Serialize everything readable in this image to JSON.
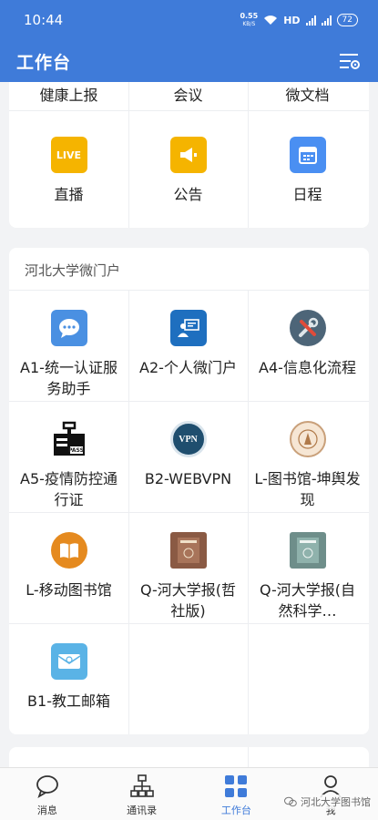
{
  "status_bar": {
    "time": "10:44",
    "net_speed": "0.55",
    "net_unit": "KB/S",
    "hd": "HD",
    "battery": "72"
  },
  "app_bar": {
    "title": "工作台"
  },
  "section_top": {
    "items": [
      {
        "label": "健康上报"
      },
      {
        "label": "会议"
      },
      {
        "label": "微文档"
      },
      {
        "label": "直播",
        "icon_text": "LIVE"
      },
      {
        "label": "公告"
      },
      {
        "label": "日程"
      }
    ]
  },
  "section_portal": {
    "title": "河北大学微门户",
    "items": [
      {
        "label": "A1-统一认证服务助手"
      },
      {
        "label": "A2-个人微门户"
      },
      {
        "label": "A4-信息化流程"
      },
      {
        "label": "A5-疫情防控通行证",
        "icon_text": "PASS"
      },
      {
        "label": "B2-WEBVPN",
        "icon_text": "VPN"
      },
      {
        "label": "L-图书馆-坤舆发现"
      },
      {
        "label": "L-移动图书馆"
      },
      {
        "label": "Q-河大学报(哲社版)"
      },
      {
        "label": "Q-河大学报(自然科学…"
      },
      {
        "label": "B1-教工邮箱"
      }
    ]
  },
  "tabbar": {
    "tabs": [
      {
        "label": "消息"
      },
      {
        "label": "通讯录"
      },
      {
        "label": "工作台"
      },
      {
        "label": "我"
      }
    ],
    "active_index": 2
  },
  "watermark": "河北大学图书馆",
  "colors": {
    "primary": "#3f7bd9",
    "live_yellow": "#f5b400",
    "notice_yellow": "#f5b400",
    "calendar_blue": "#4a8ff2",
    "chat_blue": "#4a90e2"
  }
}
